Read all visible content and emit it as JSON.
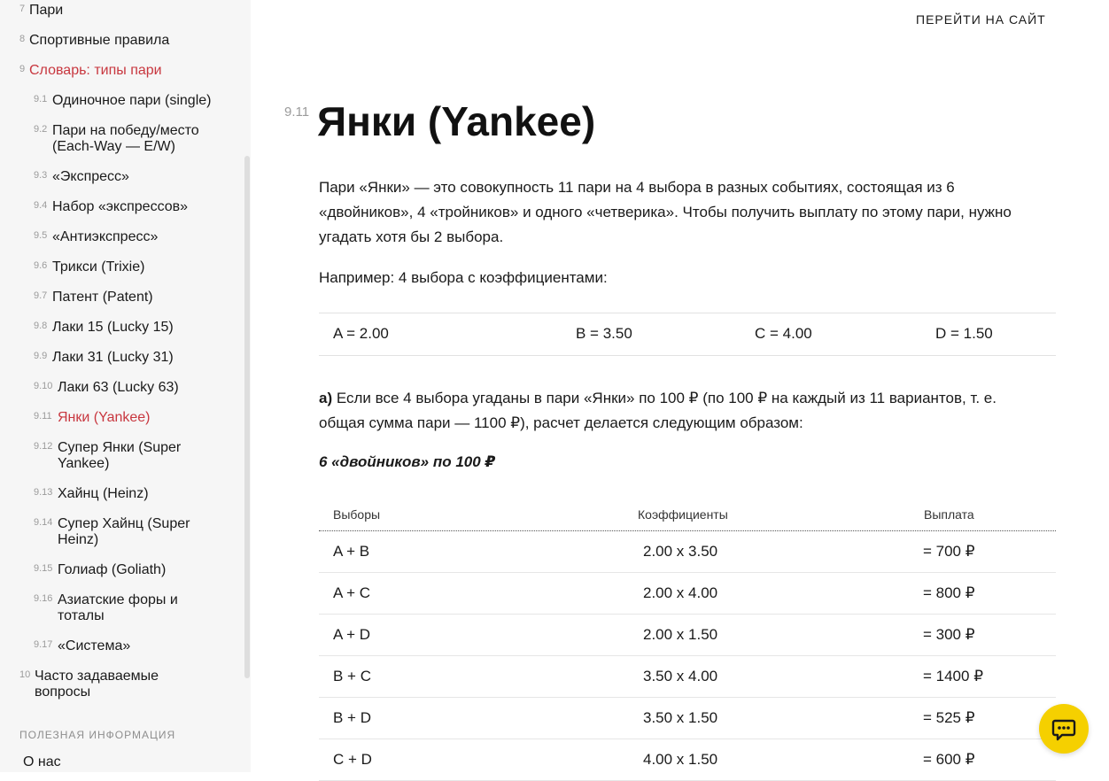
{
  "sidebar": {
    "top_items": [
      {
        "num": "7",
        "label": "Пари"
      },
      {
        "num": "8",
        "label": "Спортивные правила"
      },
      {
        "num": "9",
        "label": "Словарь: типы пари"
      }
    ],
    "sub_items": [
      {
        "num": "9.1",
        "label": "Одиночное пари (single)"
      },
      {
        "num": "9.2",
        "label": "Пари на победу/место (Each-Way — E/W)"
      },
      {
        "num": "9.3",
        "label": "«Экспресс»"
      },
      {
        "num": "9.4",
        "label": "Набор «экспрессов»"
      },
      {
        "num": "9.5",
        "label": "«Антиэкспресс»"
      },
      {
        "num": "9.6",
        "label": "Трикси (Trixie)"
      },
      {
        "num": "9.7",
        "label": "Патент (Patent)"
      },
      {
        "num": "9.8",
        "label": "Лаки 15 (Lucky 15)"
      },
      {
        "num": "9.9",
        "label": "Лаки 31 (Lucky 31)"
      },
      {
        "num": "9.10",
        "label": "Лаки 63 (Lucky 63)"
      },
      {
        "num": "9.11",
        "label": "Янки (Yankee)"
      },
      {
        "num": "9.12",
        "label": "Супер Янки (Super Yankee)"
      },
      {
        "num": "9.13",
        "label": "Хайнц (Heinz)"
      },
      {
        "num": "9.14",
        "label": "Супер Хайнц (Super Heinz)"
      },
      {
        "num": "9.15",
        "label": "Голиаф (Goliath)"
      },
      {
        "num": "9.16",
        "label": "Азиатские форы и тоталы"
      },
      {
        "num": "9.17",
        "label": "«Система»"
      }
    ],
    "faq": {
      "num": "10",
      "label": "Часто задаваемые вопросы"
    },
    "section_label": "ПОЛЕЗНАЯ ИНФОРМАЦИЯ",
    "about": "О нас"
  },
  "header": {
    "goto_site": "ПЕРЕЙТИ НА САЙТ"
  },
  "main": {
    "section_num": "9.11",
    "title": "Янки (Yankee)",
    "intro": "Пари «Янки» — это совокупность 11 пари на 4 выбора в разных событиях, состоящая из 6 «двойников», 4 «тройников» и одного «четверика». Чтобы получить выплату по этому пари, нужно угадать хотя бы 2 выбора.",
    "example": "Например: 4 выбора с коэффициентами:",
    "odds": [
      "A = 2.00",
      "B = 3.50",
      "C = 4.00",
      "D = 1.50"
    ],
    "case_a_label": "а)",
    "case_a_text": " Если все 4 выбора угаданы в пари «Янки» по 100 ₽ (по 100 ₽ на каждый из 11 вариантов, т. е. общая сумма пари — 1100 ₽), расчет делается следующим образом:",
    "doubles_heading": "6 «двойников» по 100 ₽",
    "table": {
      "headers": [
        "Выборы",
        "Коэффициенты",
        "Выплата"
      ],
      "rows": [
        [
          "A + B",
          "2.00 x 3.50",
          "= 700 ₽"
        ],
        [
          "A + C",
          "2.00 x 4.00",
          "= 800 ₽"
        ],
        [
          "A + D",
          "2.00 x 1.50",
          "= 300 ₽"
        ],
        [
          "B + C",
          "3.50 x 4.00",
          "= 1400 ₽"
        ],
        [
          "B + D",
          "3.50 x 1.50",
          "= 525 ₽"
        ],
        [
          "C + D",
          "4.00 x 1.50",
          "= 600 ₽"
        ]
      ]
    }
  },
  "chat": {
    "icon": "chat-icon",
    "color": "#f5d000"
  },
  "colors": {
    "accent": "#c8373f",
    "sidebar_bg": "#f6f6f6"
  }
}
